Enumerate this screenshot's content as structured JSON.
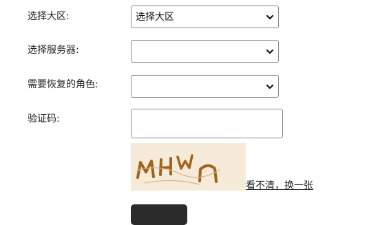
{
  "form": {
    "region": {
      "label": "选择大区:",
      "selected": "选择大区"
    },
    "server": {
      "label": "选择服务器:",
      "selected": ""
    },
    "character": {
      "label": "需要恢复的角色:",
      "selected": ""
    },
    "captcha": {
      "label": "验证码:",
      "value": "",
      "refresh_link": "看不清，换一张"
    }
  },
  "icons": {
    "select_arrow": "chevron-down-icon",
    "captcha_image": "captcha-image"
  },
  "colors": {
    "captcha_background": "#f6ead9",
    "captcha_text": "#a0641e",
    "button": "#2b2b2b"
  }
}
